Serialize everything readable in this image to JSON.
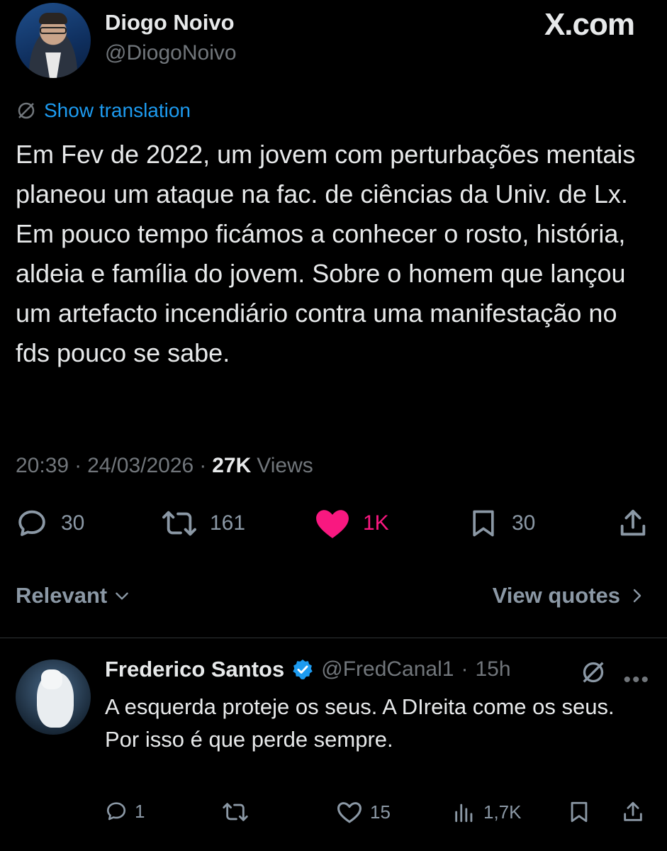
{
  "header": {
    "author_name": "Diogo Noivo",
    "author_handle": "@DiogoNoivo",
    "brand": "X.com"
  },
  "tweet": {
    "translate_label": "Show translation",
    "text": "Em Fev de 2022, um jovem com perturbações mentais planeou um ataque na fac. de ciências da Univ. de Lx. Em pouco tempo ficámos a conhecer o rosto, história, aldeia e família do jovem. Sobre o homem que lançou um artefacto incendiário contra uma manifestação no fds pouco se sabe.",
    "time": "20:39",
    "date": "24/03/2026",
    "views_count": "27K",
    "views_label": "Views",
    "replies": "30",
    "reposts": "161",
    "likes": "1K",
    "bookmarks": "30"
  },
  "filters": {
    "sort_label": "Relevant",
    "quotes_label": "View quotes"
  },
  "reply": {
    "name": "Frederico Santos",
    "handle": "@FredCanal1",
    "age": "15h",
    "text": "A esquerda proteje os seus. A DIreita come os seus.\nPor isso é que perde sempre.",
    "replies": "1",
    "likes": "15",
    "views": "1,7K"
  },
  "colors": {
    "background": "#000000",
    "text": "#e7e9ea",
    "muted": "#71767b",
    "link": "#1d9bf0",
    "like_active": "#f91880",
    "verified": "#1d9bf0"
  },
  "icons": [
    "globe-slash-icon",
    "reply-icon",
    "repost-icon",
    "heart-icon",
    "bookmark-icon",
    "share-icon",
    "chevron-down-icon",
    "chevron-right-icon",
    "verified-icon",
    "more-icon",
    "views-icon"
  ]
}
